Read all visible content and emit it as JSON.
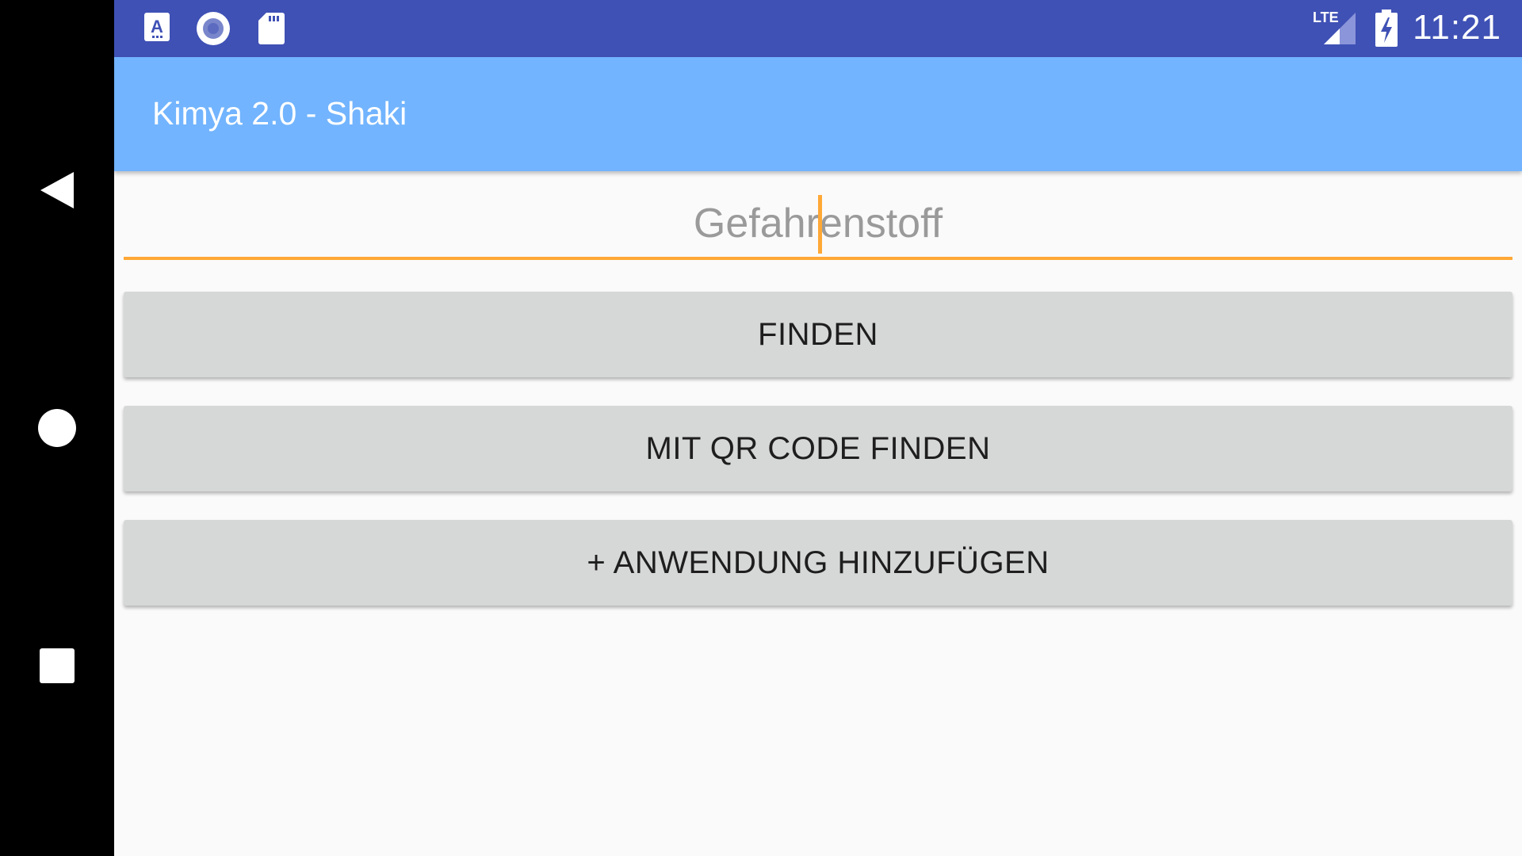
{
  "status_bar": {
    "time": "11:21",
    "network": "LTE",
    "icons": [
      "a-keyboard-icon",
      "record-icon",
      "sd-card-icon",
      "lte-signal-icon",
      "battery-charging-icon"
    ]
  },
  "app_bar": {
    "title": "Kimya 2.0 - Shaki"
  },
  "search": {
    "placeholder": "Gefahrenstoff",
    "value": ""
  },
  "buttons": {
    "find": "FINDEN",
    "find_qr": "MIT QR CODE FINDEN",
    "add_application": "+ ANWENDUNG HINZUFÜGEN"
  },
  "nav_bar": {
    "icons": [
      "back-icon",
      "home-icon",
      "recents-icon"
    ]
  },
  "colors": {
    "status_bar": "#3f51b5",
    "app_bar": "#72b4ff",
    "accent": "#ffa836",
    "button": "#d6d7d7",
    "background": "#fafafa"
  }
}
